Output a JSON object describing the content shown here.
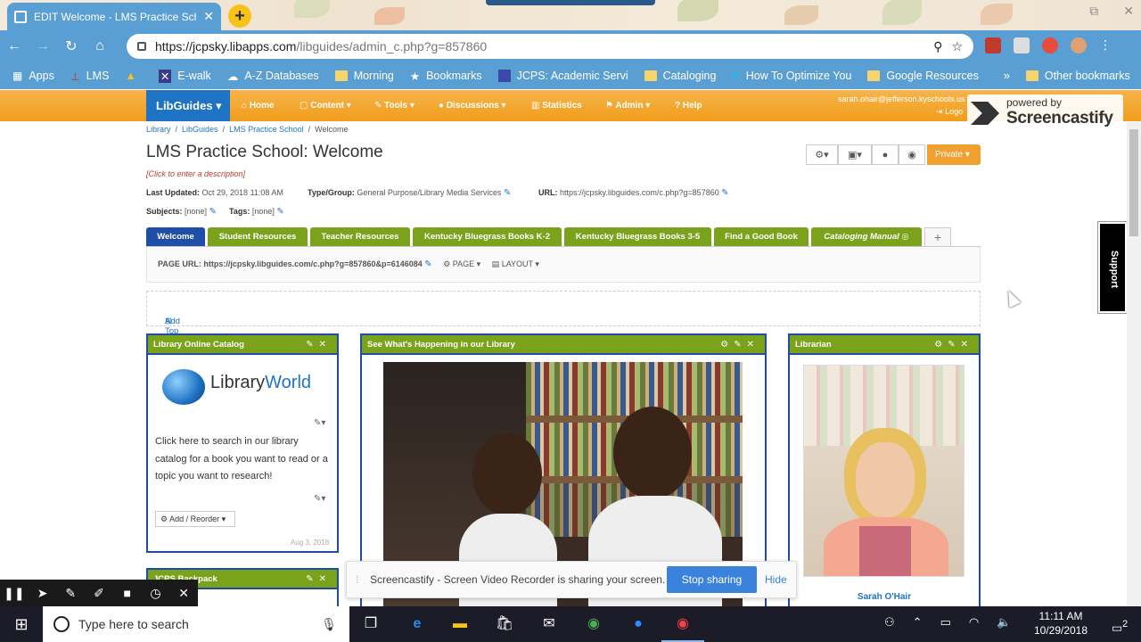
{
  "browser": {
    "tab_title": "EDIT Welcome - LMS Practice Scho",
    "url_host": "https://jcpsky.libapps.com",
    "url_path": "/libguides/admin_c.php?g=857860",
    "bookmarks": [
      {
        "label": "Apps"
      },
      {
        "label": "LMS"
      },
      {
        "label": ""
      },
      {
        "label": "E-walk"
      },
      {
        "label": "A-Z Databases"
      },
      {
        "label": "Morning"
      },
      {
        "label": "Bookmarks"
      },
      {
        "label": "JCPS: Academic Servi"
      },
      {
        "label": "Cataloging"
      },
      {
        "label": "How To Optimize You"
      },
      {
        "label": "Google Resources"
      }
    ],
    "bookmarks_more": "»",
    "other_bookmarks": "Other bookmarks"
  },
  "libguides_nav": {
    "brand": "LibGuides",
    "items": [
      {
        "label": "Home"
      },
      {
        "label": "Content"
      },
      {
        "label": "Tools"
      },
      {
        "label": "Discussions"
      },
      {
        "label": "Statistics"
      },
      {
        "label": "Admin"
      },
      {
        "label": "Help"
      }
    ],
    "user_email": "sarah.ohair@jefferson.kyschools.us",
    "logout": "Logo"
  },
  "screencastify": {
    "powered_by": "powered by",
    "brand": "Screencastify",
    "share_message": "Screencastify - Screen Video Recorder is sharing your screen.",
    "stop_sharing": "Stop sharing",
    "hide": "Hide"
  },
  "breadcrumb": [
    "Library",
    "LibGuides",
    "LMS Practice School",
    "Welcome"
  ],
  "page": {
    "title": "LMS Practice School: Welcome",
    "description_prompt": "[Click to enter a description]",
    "last_updated_label": "Last Updated:",
    "last_updated": "Oct 29, 2018 11:08 AM",
    "type_label": "Type/Group:",
    "type_value": "General Purpose/Library Media Services",
    "url_label": "URL:",
    "url_value": "https://jcpsky.libguides.com/c.php?g=857860",
    "subjects_label": "Subjects:",
    "subjects_value": "[none]",
    "tags_label": "Tags:",
    "tags_value": "[none]",
    "private_label": "Private"
  },
  "guide_tabs": [
    {
      "label": "Welcome"
    },
    {
      "label": "Student Resources"
    },
    {
      "label": "Teacher Resources"
    },
    {
      "label": "Kentucky Bluegrass Books K-2"
    },
    {
      "label": "Kentucky Bluegrass Books 3-5"
    },
    {
      "label": "Find a Good Book"
    },
    {
      "label": "Cataloging Manual"
    }
  ],
  "page_bar": {
    "page_url": "PAGE URL: https://jcpsky.libguides.com/c.php?g=857860&p=6146084",
    "page_menu": "PAGE",
    "layout_menu": "LAYOUT"
  },
  "add_top_box": "Add Top Box",
  "boxes": {
    "catalog": {
      "title": "Library Online Catalog",
      "logo_text_a": "Library",
      "logo_text_b": "World",
      "text": "Click here to search in our library catalog for a book you want to read or a topic you want to research!",
      "add_reorder": "Add / Reorder",
      "date": "Aug 3, 2018"
    },
    "happening": {
      "title": "See What's Happening in our Library"
    },
    "librarian": {
      "title": "Librarian",
      "name": "Sarah O'Hair"
    },
    "backpack": {
      "title": "JCPS Backpack"
    }
  },
  "support_tab": "Support",
  "taskbar": {
    "search_placeholder": "Type here to search",
    "time": "11:11 AM",
    "date": "10/29/2018",
    "notifications": "2"
  },
  "colors": {
    "chrome_blue": "#5a9fd4",
    "libguides_orange": "#f5a623",
    "libguides_blue": "#1f73c4",
    "tab_green": "#7aa21b",
    "active_tab_blue": "#1f4ea8"
  }
}
